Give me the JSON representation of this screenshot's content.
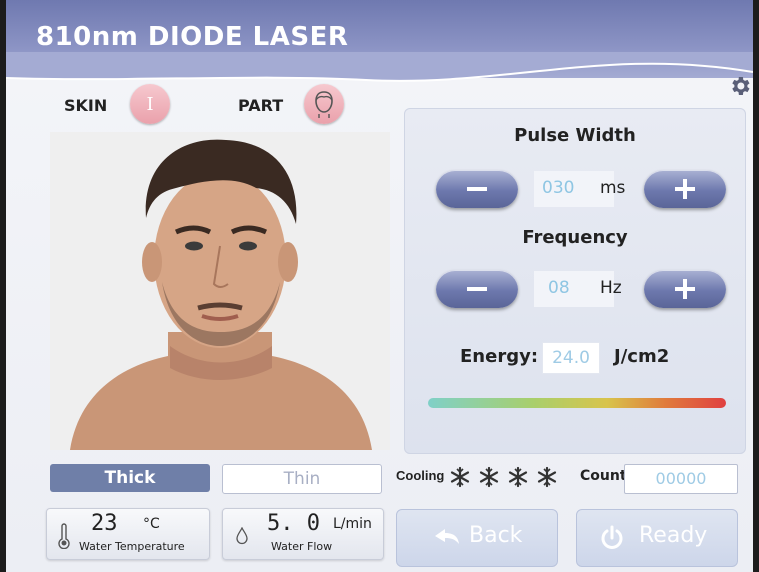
{
  "header": {
    "title": "810nm DIODE LASER"
  },
  "selectors": {
    "skin_label": "SKIN",
    "skin_value": "I",
    "part_label": "PART"
  },
  "pulse_width": {
    "title": "Pulse Width",
    "value": "030",
    "unit": "ms"
  },
  "frequency": {
    "title": "Frequency",
    "value": "08",
    "unit": "Hz"
  },
  "energy": {
    "label": "Energy:",
    "value": "24.0",
    "unit": "J/cm2",
    "level": 0.6
  },
  "modes": {
    "thick": "Thick",
    "thin": "Thin",
    "selected": "Thick"
  },
  "cooling": {
    "label": "Cooling",
    "level": 4
  },
  "count": {
    "label": "Count",
    "value": "00000"
  },
  "water_temp": {
    "value": "23",
    "unit": "°C",
    "label": "Water Temperature"
  },
  "water_flow": {
    "value": "5. 0",
    "unit": "L/min",
    "label": "Water Flow"
  },
  "actions": {
    "back": "Back",
    "ready": "Ready"
  },
  "icons": [
    "gear-icon",
    "face-icon",
    "minus-icon",
    "plus-icon",
    "thermometer-icon",
    "water-drop-icon",
    "snowflake-icon",
    "back-arrow-icon",
    "power-icon"
  ],
  "colors": {
    "header": "#7d86bb",
    "accent": "#6d78ad",
    "value_blue": "#8fc6e3",
    "thick_selected": "#6f7fa8"
  }
}
